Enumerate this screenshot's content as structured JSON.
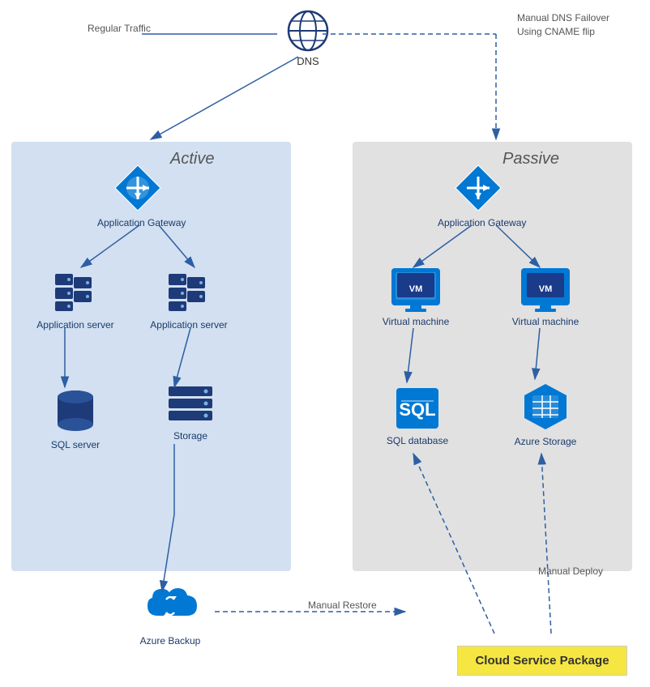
{
  "labels": {
    "dns": "DNS",
    "regular_traffic": "Regular Traffic",
    "manual_dns_failover": "Manual DNS Failover",
    "using_cname_flip": "Using CNAME flip",
    "active": "Active",
    "passive": "Passive",
    "application_gateway_active": "Application Gateway",
    "application_gateway_passive": "Application Gateway",
    "app_server_1": "Application server",
    "app_server_2": "Application server",
    "virtual_machine_1": "Virtual machine",
    "virtual_machine_2": "Virtual machine",
    "sql_server": "SQL server",
    "storage": "Storage",
    "sql_database": "SQL database",
    "azure_storage": "Azure Storage",
    "azure_backup": "Azure Backup",
    "manual_restore": "Manual Restore",
    "manual_deploy": "Manual Deploy",
    "cloud_service_package": "Cloud Service Package"
  },
  "colors": {
    "blue_dark": "#1e3a78",
    "blue_mid": "#0078d4",
    "blue_light_bg": "#adc6e6",
    "grey_bg": "#c8c8c8",
    "arrow_solid": "#2e5fa3",
    "arrow_dashed": "#2e5fa3",
    "yellow": "#f5e642"
  }
}
